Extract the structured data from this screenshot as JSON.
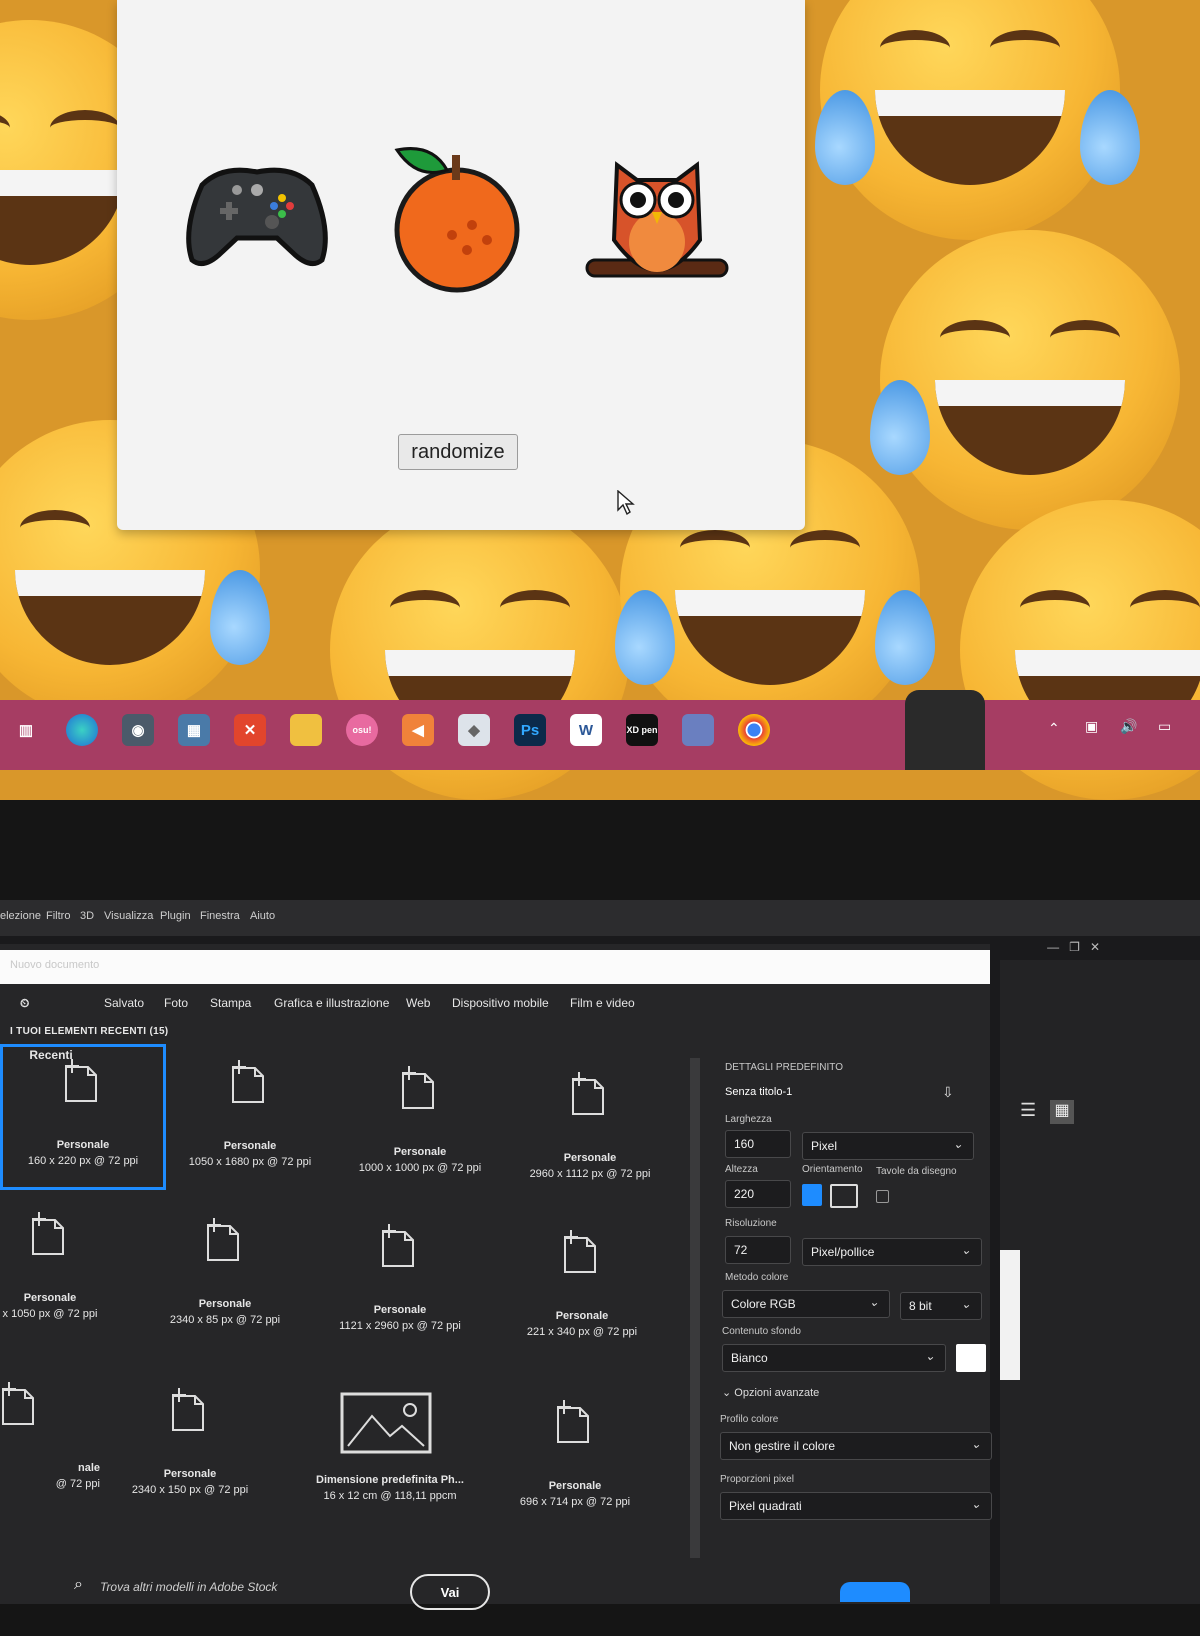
{
  "game": {
    "icons": [
      "game-controller-icon",
      "orange-icon",
      "owl-icon"
    ],
    "randomize_label": "randomize"
  },
  "taskbar": {
    "apps": [
      "task-view-icon",
      "edge-icon",
      "camera-icon",
      "calculator-icon",
      "x-app-icon",
      "file-explorer-icon",
      "osu-icon",
      "app-icon",
      "cube-app-icon",
      "photoshop-icon",
      "word-icon",
      "xd-pen-icon",
      "anime-app-icon",
      "chrome-icon"
    ],
    "osu_label": "osu!",
    "ps_label": "Ps",
    "word_label": "W",
    "xd_label": "XD pen"
  },
  "photoshop": {
    "menu": [
      "elezione",
      "Filtro",
      "3D",
      "Visualizza",
      "Plugin",
      "Finestra",
      "Aiuto"
    ],
    "title_placeholder": "Nuovo documento",
    "tabs": [
      "Recenti",
      "Salvato",
      "Foto",
      "Stampa",
      "Grafica e illustrazione",
      "Web",
      "Dispositivo mobile",
      "Film e video"
    ],
    "recent_header": "I TUOI ELEMENTI RECENTI",
    "recent_count": "(15)",
    "presets": [
      {
        "name": "Personale",
        "size": "160 x 220 px @ 72 ppi"
      },
      {
        "name": "Personale",
        "size": "1050 x 1680 px @ 72 ppi"
      },
      {
        "name": "Personale",
        "size": "1000 x 1000 px @ 72 ppi"
      },
      {
        "name": "Personale",
        "size": "2960 x 1112 px @ 72 ppi"
      },
      {
        "name": "Personale",
        "size": "x 1050 px @ 72 ppi"
      },
      {
        "name": "Personale",
        "size": "2340 x 85 px @ 72 ppi"
      },
      {
        "name": "Personale",
        "size": "1121 x 2960 px @ 72 ppi"
      },
      {
        "name": "Personale",
        "size": "221 x 340 px @ 72 ppi"
      },
      {
        "name": "nale",
        "size": "@ 72 ppi"
      },
      {
        "name": "Personale",
        "size": "2340 x 150 px @ 72 ppi"
      },
      {
        "name": "Dimensione predefinita Ph...",
        "size": "16 x 12 cm @ 118,11 ppcm"
      },
      {
        "name": "Personale",
        "size": "696 x 714 px @ 72 ppi"
      }
    ],
    "search_placeholder": "Trova altri modelli in Adobe Stock",
    "go_label": "Vai",
    "details": {
      "header": "DETTAGLI PREDEFINITO",
      "doc_name": "Senza titolo-1",
      "width_label": "Larghezza",
      "width_value": "160",
      "width_unit": "Pixel",
      "height_label": "Altezza",
      "height_value": "220",
      "orientation_label": "Orientamento",
      "artboards_label": "Tavole da disegno",
      "resolution_label": "Risoluzione",
      "resolution_value": "72",
      "resolution_unit": "Pixel/pollice",
      "color_mode_label": "Metodo colore",
      "color_mode_value": "Colore RGB",
      "bit_depth": "8 bit",
      "background_label": "Contenuto sfondo",
      "background_value": "Bianco",
      "advanced_label": "Opzioni avanzate",
      "profile_label": "Profilo colore",
      "profile_value": "Non gestire il colore",
      "pixel_aspect_label": "Proporzioni pixel",
      "pixel_aspect_value": "Pixel quadrati"
    }
  }
}
